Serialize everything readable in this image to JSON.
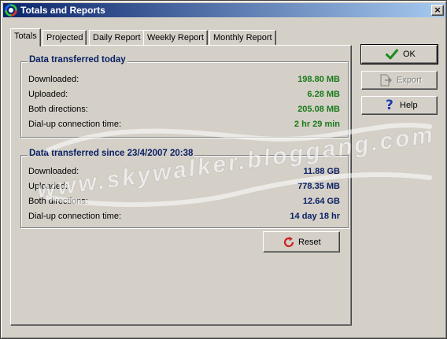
{
  "window": {
    "title": "Totals and Reports",
    "close_glyph": "×"
  },
  "tabs": [
    {
      "label": "Totals",
      "active": true
    },
    {
      "label": "Projected",
      "active": false
    },
    {
      "label": "Daily Report",
      "active": false
    },
    {
      "label": "Weekly Report",
      "active": false
    },
    {
      "label": "Monthly Report",
      "active": false
    }
  ],
  "today": {
    "title": "Data transferred today",
    "rows": [
      {
        "label": "Downloaded:",
        "value": "198.80 MB"
      },
      {
        "label": "Uploaded:",
        "value": "6.28 MB"
      },
      {
        "label": "Both directions:",
        "value": "205.08 MB"
      },
      {
        "label": "Dial-up connection time:",
        "value": "2 hr 29 min"
      }
    ]
  },
  "since": {
    "title": "Data transferred since 23/4/2007 20:38",
    "rows": [
      {
        "label": "Downloaded:",
        "value": "11.88 GB"
      },
      {
        "label": "Uploaded:",
        "value": "778.35 MB"
      },
      {
        "label": "Both directions:",
        "value": "12.64 GB"
      },
      {
        "label": "Dial-up connection time:",
        "value": "14 day 18 hr"
      }
    ]
  },
  "buttons": {
    "ok": "OK",
    "export": "Export",
    "help": "Help",
    "reset": "Reset"
  },
  "watermark": "www.skywalker.bloggang.com",
  "icons": {
    "app": "app-ring-icon",
    "ok": "checkmark-icon",
    "export": "export-icon",
    "help": "question-mark-icon",
    "reset": "refresh-icon"
  },
  "colors": {
    "title_gradient_start": "#0a246a",
    "title_gradient_end": "#a6caf0",
    "group_title": "#0a2064",
    "today_values": "#1a7a1a",
    "since_values": "#0a2064",
    "ok_check": "#1c8c1c",
    "help_mark": "#1a3ab0",
    "reset_icon": "#cc2020"
  }
}
